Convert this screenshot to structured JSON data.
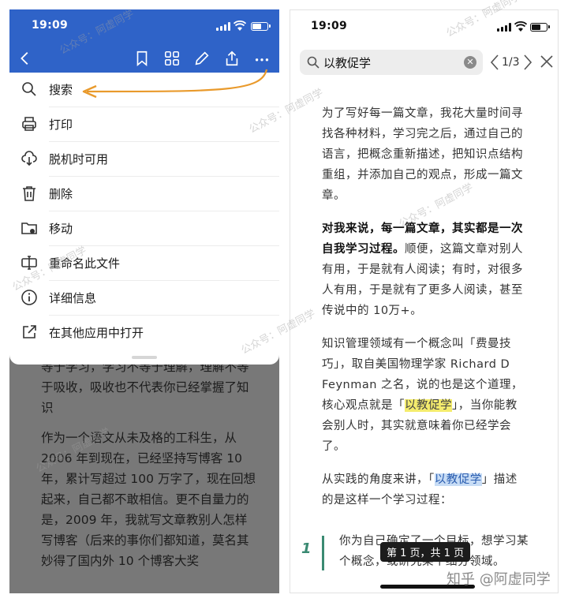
{
  "left": {
    "status": {
      "time": "19:09"
    },
    "menu": [
      {
        "icon": "search-icon",
        "label": "搜索"
      },
      {
        "icon": "printer-icon",
        "label": "打印"
      },
      {
        "icon": "cloud-download-icon",
        "label": "脱机时可用"
      },
      {
        "icon": "trash-icon",
        "label": "删除"
      },
      {
        "icon": "folder-move-icon",
        "label": "移动"
      },
      {
        "icon": "rename-icon",
        "label": "重命名此文件"
      },
      {
        "icon": "info-icon",
        "label": "详细信息"
      },
      {
        "icon": "open-external-icon",
        "label": "在其他应用中打开"
      }
    ],
    "behind_paragraphs": [
      "等于学习，学习不等于理解，理解不等于吸收，吸收也不代表你已经掌握了知识",
      "作为一个语文从未及格的工科生，从 2006 年到现在，已经坚持写博客 10 年，累计写超过 100 万字了，现在回想起来，自己都不敢相信。更不自量力的是，2009 年，我就写文章教别人怎样写博客（后来的事你们都知道，莫名其妙得了国内外 10 个博客大奖"
    ]
  },
  "right": {
    "status": {
      "time": "19:09"
    },
    "search": {
      "value": "以教促学",
      "counter": "1/3"
    },
    "paragraphs": {
      "p1": "为了写好每一篇文章，我花大量时间寻找各种材料，学习完之后，通过自己的语言，把概念重新描述，把知识点结构重组，并添加自己的观点，形成一篇文章。",
      "p2_bold": "对我来说，每一篇文章，其实都是一次自我学习过程。",
      "p2_rest": "顺便，这篇文章对别人有用，于是就有人阅读；有时，对很多人有用，于是就有了更多人阅读，甚至传说中的 10万+。",
      "p3_before": "知识管理领域有一个概念叫「费曼技巧」，取自美国物理学家 Richard D Feynman 之名，说的也是这个道理，核心观点就是「",
      "p3_hl": "以教促学",
      "p3_after": "」，当你能教会别人时，其实就意味着你已经学会了。",
      "p4_before": "从实践的角度来讲，「",
      "p4_hl": "以教促学",
      "p4_after": "」描述的是这样一个学习过程："
    },
    "quote": {
      "number": "1",
      "text": "你为自己确定了一个目标，想学习某个概念，或研究某个细分领域。"
    },
    "page_toast": "第 1 页，共 1 页"
  },
  "watermarks": {
    "gzh": "公众号：阿虚同学",
    "zhihu": "知乎 @阿虚同学"
  },
  "colors": {
    "toolbar_blue": "#2f63c8",
    "arrow_orange": "#e99a2c",
    "highlight_current": "#f4ec6d",
    "highlight_other": "#c7dcf5"
  }
}
